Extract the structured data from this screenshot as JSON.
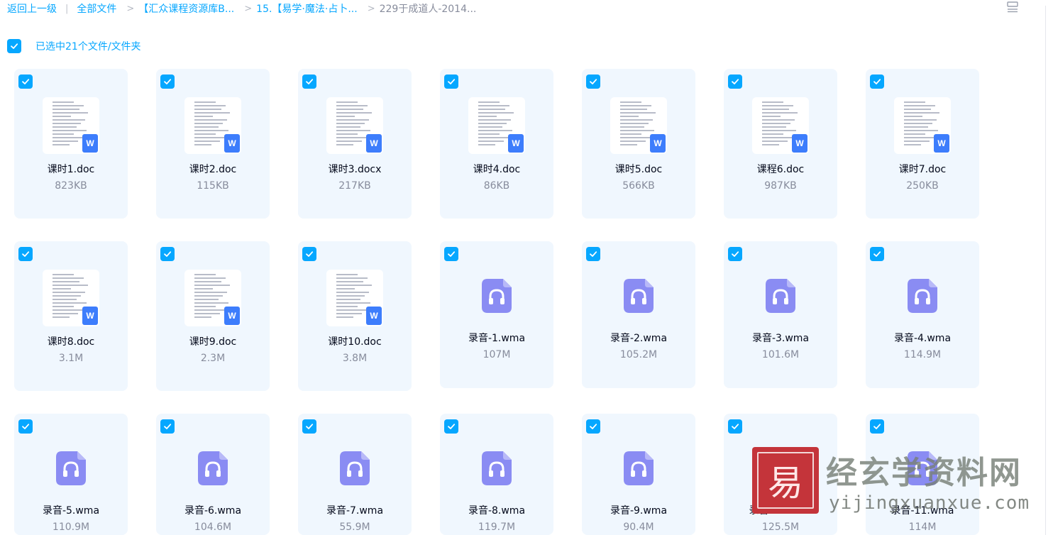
{
  "breadcrumb": {
    "back": "返回上一级",
    "all_files": "全部文件",
    "level1": "【汇众课程资源库B...",
    "level2": "15.【易学·魔法·占卜...",
    "current": "229于成道人-2014...",
    "separator": "|",
    "arrow": ">"
  },
  "toolbar": {
    "view_toggle_icon": "list-view-icon"
  },
  "selection": {
    "label": "已选中21个文件/文件夹",
    "checked": true
  },
  "colors": {
    "accent": "#06a7ff",
    "card_bg": "#f0f7fe",
    "audio_icon": "#8a8cf3",
    "word_badge": "#3d7dfc"
  },
  "files": [
    {
      "name": "课时1.doc",
      "size": "823KB",
      "type": "doc",
      "checked": true
    },
    {
      "name": "课时2.doc",
      "size": "115KB",
      "type": "doc",
      "checked": true
    },
    {
      "name": "课时3.docx",
      "size": "217KB",
      "type": "doc",
      "checked": true
    },
    {
      "name": "课时4.doc",
      "size": "86KB",
      "type": "doc",
      "checked": true
    },
    {
      "name": "课时5.doc",
      "size": "566KB",
      "type": "doc",
      "checked": true
    },
    {
      "name": "课程6.doc",
      "size": "987KB",
      "type": "doc",
      "checked": true
    },
    {
      "name": "课时7.doc",
      "size": "250KB",
      "type": "doc",
      "checked": true
    },
    {
      "name": "课时8.doc",
      "size": "3.1M",
      "type": "doc",
      "checked": true
    },
    {
      "name": "课时9.doc",
      "size": "2.3M",
      "type": "doc",
      "checked": true
    },
    {
      "name": "课时10.doc",
      "size": "3.8M",
      "type": "doc",
      "checked": true
    },
    {
      "name": "录音-1.wma",
      "size": "107M",
      "type": "audio",
      "checked": true
    },
    {
      "name": "录音-2.wma",
      "size": "105.2M",
      "type": "audio",
      "checked": true
    },
    {
      "name": "录音-3.wma",
      "size": "101.6M",
      "type": "audio",
      "checked": true
    },
    {
      "name": "录音-4.wma",
      "size": "114.9M",
      "type": "audio",
      "checked": true
    },
    {
      "name": "录音-5.wma",
      "size": "110.9M",
      "type": "audio",
      "checked": true
    },
    {
      "name": "录音-6.wma",
      "size": "104.6M",
      "type": "audio",
      "checked": true
    },
    {
      "name": "录音-7.wma",
      "size": "55.9M",
      "type": "audio",
      "checked": true
    },
    {
      "name": "录音-8.wma",
      "size": "119.7M",
      "type": "audio",
      "checked": true
    },
    {
      "name": "录音-9.wma",
      "size": "90.4M",
      "type": "audio",
      "checked": true
    },
    {
      "name": "录音-10.wma",
      "size": "125.5M",
      "type": "audio",
      "checked": true
    },
    {
      "name": "录音-11.wma",
      "size": "114M",
      "type": "audio",
      "checked": true
    }
  ],
  "watermark": {
    "seal_glyph": "易",
    "title": "经玄学资料网",
    "url": "yijingxuanxue.com"
  }
}
